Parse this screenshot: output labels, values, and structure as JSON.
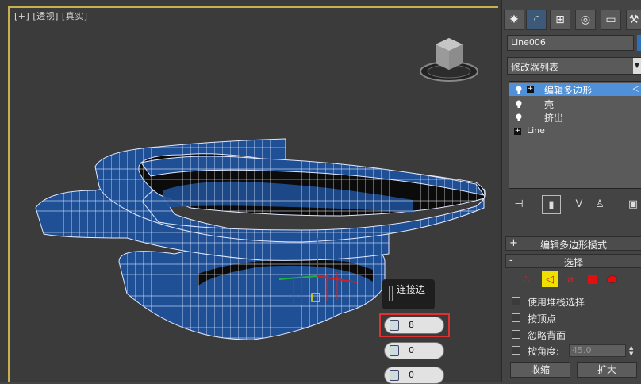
{
  "viewport": {
    "label_plus": "[+]",
    "label_view": "[透视]",
    "label_shading": "[真实]",
    "viewcube_icon": "viewcube-icon",
    "caddy": {
      "title": "连接边",
      "segments": "8",
      "pinch": "0",
      "slide": "0"
    },
    "accent_frame": "#c8b050",
    "highlight": "#e03030"
  },
  "panel": {
    "tabs": [
      "create-icon",
      "modify-icon",
      "hierarchy-icon",
      "motion-icon",
      "display-icon",
      "utilities-icon"
    ],
    "object_name": "Line006",
    "object_color": "#2e6fc0",
    "modifier_list": "修改器列表",
    "stack": [
      {
        "label": "编辑多边形",
        "selected": true
      },
      {
        "label": "壳",
        "selected": false
      },
      {
        "label": "挤出",
        "selected": false
      },
      {
        "label": "Line",
        "selected": false
      }
    ],
    "rollout_edit_mode": "编辑多边形模式",
    "rollout_selection": "选择",
    "rollout_plus": "+",
    "rollout_minus": "-",
    "use_stack_selection": "使用堆栈选择",
    "by_vertex": "按顶点",
    "ignore_backfacing": "忽略背面",
    "by_angle": "按角度:",
    "angle_value": "45.0",
    "shrink": "收缩",
    "grow": "扩大"
  }
}
